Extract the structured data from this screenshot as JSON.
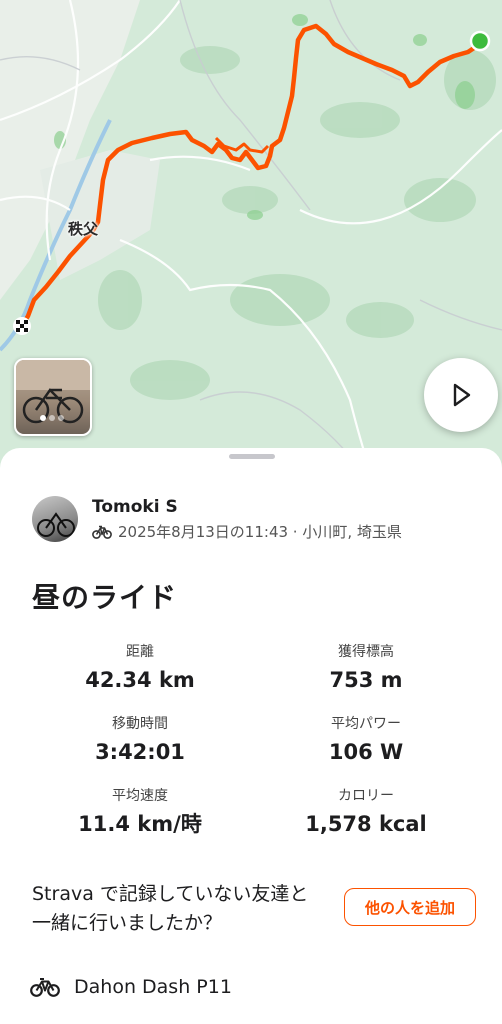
{
  "map": {
    "place_label": "秩父",
    "route_color": "#fc5200",
    "start_color": "#3dbb3d",
    "photo_count_indicator": 3
  },
  "activity": {
    "athlete_name": "Tomoki S",
    "meta": "2025年8月13日の11:43 · 小川町, 埼玉県",
    "title": "昼のライド",
    "sport_icon": "bike-icon"
  },
  "stats": [
    {
      "label": "距離",
      "value": "42.34 km"
    },
    {
      "label": "獲得標高",
      "value": "753 m"
    },
    {
      "label": "移動時間",
      "value": "3:42:01"
    },
    {
      "label": "平均パワー",
      "value": "106 W"
    },
    {
      "label": "平均速度",
      "value": "11.4 km/時"
    },
    {
      "label": "カロリー",
      "value": "1,578 kcal"
    }
  ],
  "prompt": {
    "text": "Strava で記録していない友達と一緒に行いましたか？",
    "button_label": "他の人を追加"
  },
  "gear": {
    "name": "Dahon Dash P11"
  },
  "colors": {
    "accent": "#fc5200",
    "text": "#1d1d1f",
    "map_green": "#cfe7d6"
  }
}
